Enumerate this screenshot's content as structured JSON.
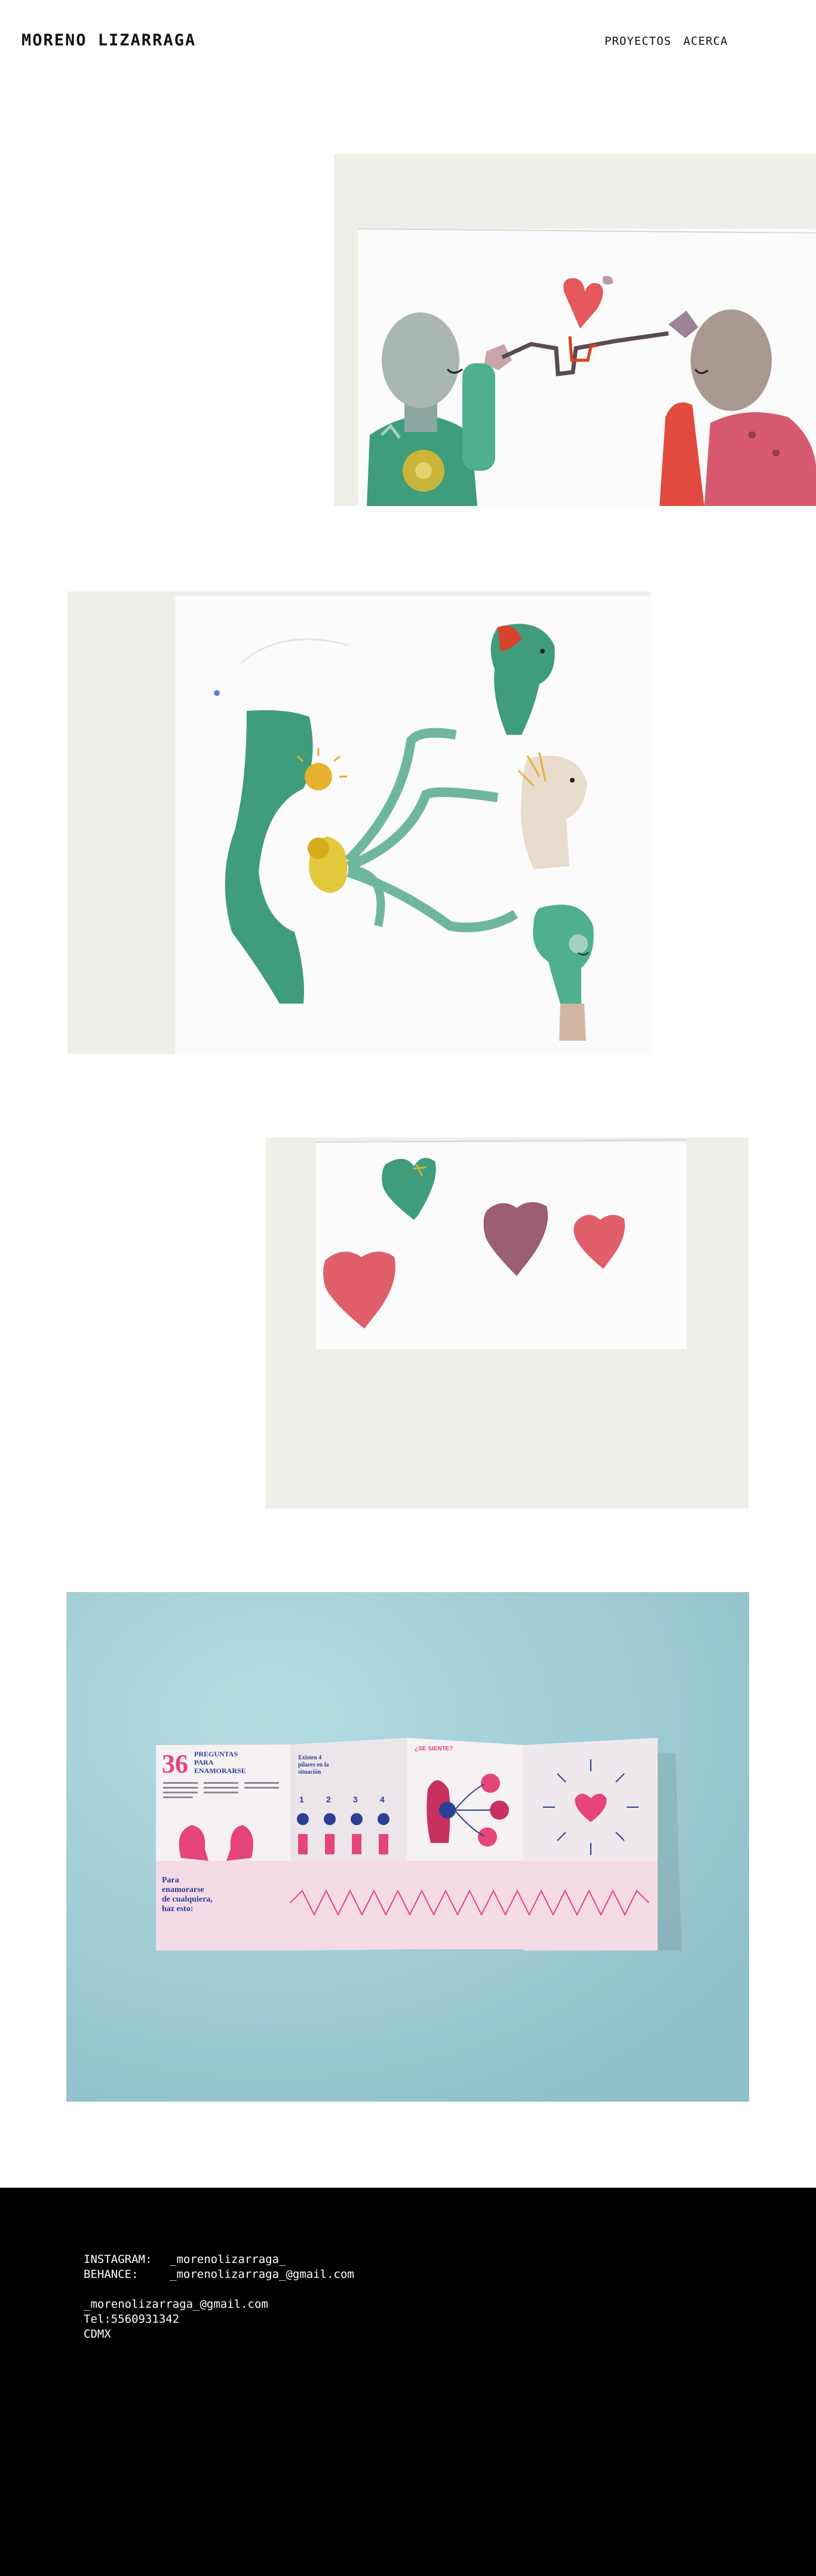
{
  "header": {
    "brand": "MORENO LIZARRAGA",
    "nav": [
      "PROYECTOS",
      "ACERCA"
    ]
  },
  "gallery": [
    {
      "name": "illustration-two-figures-heart",
      "description": ""
    },
    {
      "name": "illustration-pregnant-figure-heads",
      "description": ""
    },
    {
      "name": "illustration-hearts",
      "description": ""
    },
    {
      "name": "brochure-36-preguntas-mockup",
      "brochure_title": "36 PREGUNTAS PARA ENAMORARSE",
      "brochure_subtitle": "Para enamorarse de cualquiera, haz esto:",
      "brochure_panel2": "Existen 4 pilares en la situación",
      "brochure_steps": [
        "1",
        "2",
        "3",
        "4"
      ],
      "brochure_panel3": "¿SE SIENTE?"
    }
  ],
  "footer": {
    "instagram_label": "INSTAGRAM:",
    "instagram_value": "_morenolizarraga_",
    "behance_label": "BEHANCE:",
    "behance_value": "_morenolizarraga_@gmail.com",
    "email": "_morenolizarraga_@gmail.com",
    "tel": "Tel:5560931342",
    "city": "CDMX"
  },
  "colors": {
    "footer_bg": "#000000",
    "brochure_bg": "#a4cdd6",
    "accent_pink": "#e5457a",
    "accent_green": "#3f9d7b",
    "accent_blue": "#2c3f95"
  }
}
